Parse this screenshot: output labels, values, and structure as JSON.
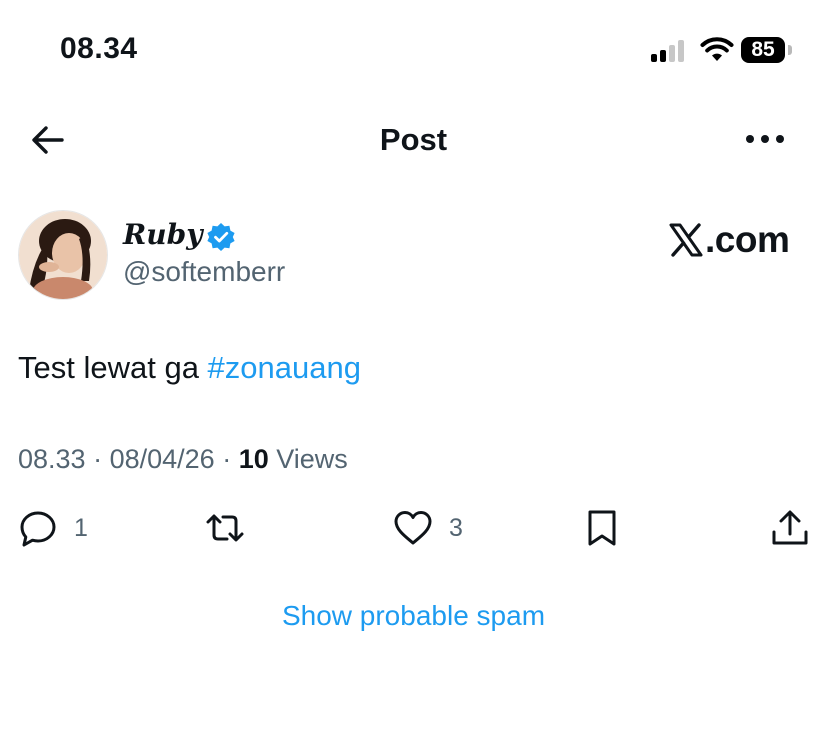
{
  "status_bar": {
    "time": "08.34",
    "battery": "85",
    "icons": [
      "signal-icon",
      "wifi-icon",
      "battery-icon"
    ]
  },
  "nav": {
    "title": "Post",
    "icons": [
      "back-arrow-icon",
      "more-options-icon"
    ]
  },
  "author": {
    "name": "Ruby",
    "handle": "@softemberr",
    "verified": true
  },
  "brand": {
    "text": ".com"
  },
  "tweet": {
    "text": "Test lewat ga ",
    "hashtag": "#zonauang"
  },
  "meta": {
    "time": "08.33",
    "separator": " · ",
    "date": "08/04/26",
    "separator2": " · ",
    "views_count": "10",
    "views_label": " Views"
  },
  "actions": {
    "reply_count": "1",
    "like_count": "3",
    "icons": [
      "reply-icon",
      "retweet-icon",
      "like-icon",
      "bookmark-icon",
      "share-icon"
    ]
  },
  "spam_link": "Show probable spam",
  "colors": {
    "accent": "#1d9bf0",
    "text": "#0f1419",
    "secondary": "#536471"
  }
}
